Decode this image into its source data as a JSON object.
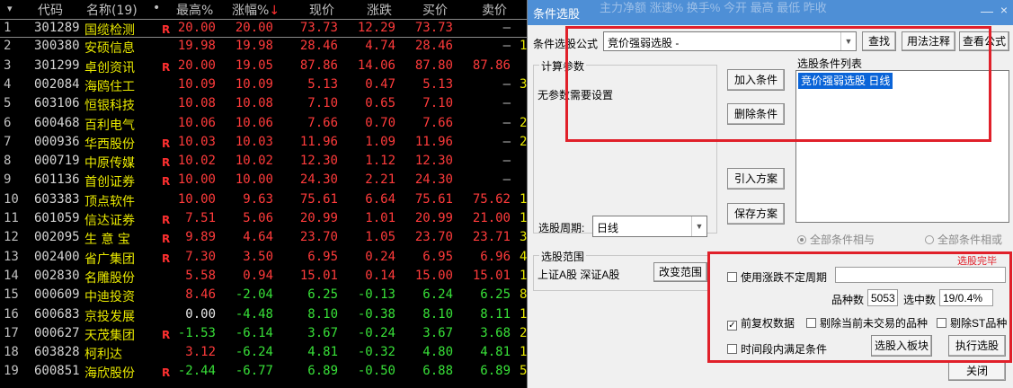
{
  "table": {
    "headers": {
      "menu": "▾",
      "code": "代码",
      "name": "名称(19)",
      "dot": "•",
      "high": "最高%",
      "chg": "涨幅%",
      "chg_sort": "↓",
      "now": "现价",
      "diff": "涨跌",
      "buy": "买价",
      "sell": "卖价"
    },
    "rows": [
      {
        "idx": "1",
        "code": "301289",
        "name": "国缆检测",
        "r": "R",
        "high": "20.00",
        "high_c": "up",
        "chg": "20.00",
        "chg_c": "up",
        "now": "73.73",
        "now_c": "up",
        "diff": "12.29",
        "diff_c": "up",
        "buy": "73.73",
        "buy_c": "up",
        "sell": "–",
        "sell_c": "dash",
        "tail": ""
      },
      {
        "idx": "2",
        "code": "300380",
        "name": "安硕信息",
        "r": "",
        "high": "19.98",
        "high_c": "up",
        "chg": "19.98",
        "chg_c": "up",
        "now": "28.46",
        "now_c": "up",
        "diff": "4.74",
        "diff_c": "up",
        "buy": "28.46",
        "buy_c": "up",
        "sell": "–",
        "sell_c": "dash",
        "tail": "1"
      },
      {
        "idx": "3",
        "code": "301299",
        "name": "卓创资讯",
        "r": "R",
        "high": "20.00",
        "high_c": "up",
        "chg": "19.05",
        "chg_c": "up",
        "now": "87.86",
        "now_c": "up",
        "diff": "14.06",
        "diff_c": "up",
        "buy": "87.80",
        "buy_c": "up",
        "sell": "87.86",
        "sell_c": "up",
        "tail": ""
      },
      {
        "idx": "4",
        "code": "002084",
        "name": "海鸥住工",
        "r": "",
        "high": "10.09",
        "high_c": "up",
        "chg": "10.09",
        "chg_c": "up",
        "now": "5.13",
        "now_c": "up",
        "diff": "0.47",
        "diff_c": "up",
        "buy": "5.13",
        "buy_c": "up",
        "sell": "–",
        "sell_c": "dash",
        "tail": "3"
      },
      {
        "idx": "5",
        "code": "603106",
        "name": "恒银科技",
        "r": "",
        "high": "10.08",
        "high_c": "up",
        "chg": "10.08",
        "chg_c": "up",
        "now": "7.10",
        "now_c": "up",
        "diff": "0.65",
        "diff_c": "up",
        "buy": "7.10",
        "buy_c": "up",
        "sell": "–",
        "sell_c": "dash",
        "tail": ""
      },
      {
        "idx": "6",
        "code": "600468",
        "name": "百利电气",
        "r": "",
        "high": "10.06",
        "high_c": "up",
        "chg": "10.06",
        "chg_c": "up",
        "now": "7.66",
        "now_c": "up",
        "diff": "0.70",
        "diff_c": "up",
        "buy": "7.66",
        "buy_c": "up",
        "sell": "–",
        "sell_c": "dash",
        "tail": "2"
      },
      {
        "idx": "7",
        "code": "000936",
        "name": "华西股份",
        "r": "R",
        "high": "10.03",
        "high_c": "up",
        "chg": "10.03",
        "chg_c": "up",
        "now": "11.96",
        "now_c": "up",
        "diff": "1.09",
        "diff_c": "up",
        "buy": "11.96",
        "buy_c": "up",
        "sell": "–",
        "sell_c": "dash",
        "tail": "2"
      },
      {
        "idx": "8",
        "code": "000719",
        "name": "中原传媒",
        "r": "R",
        "high": "10.02",
        "high_c": "up",
        "chg": "10.02",
        "chg_c": "up",
        "now": "12.30",
        "now_c": "up",
        "diff": "1.12",
        "diff_c": "up",
        "buy": "12.30",
        "buy_c": "up",
        "sell": "–",
        "sell_c": "dash",
        "tail": ""
      },
      {
        "idx": "9",
        "code": "601136",
        "name": "首创证券",
        "r": "R",
        "high": "10.00",
        "high_c": "up",
        "chg": "10.00",
        "chg_c": "up",
        "now": "24.30",
        "now_c": "up",
        "diff": "2.21",
        "diff_c": "up",
        "buy": "24.30",
        "buy_c": "up",
        "sell": "–",
        "sell_c": "dash",
        "tail": ""
      },
      {
        "idx": "10",
        "code": "603383",
        "name": "顶点软件",
        "r": "",
        "high": "10.00",
        "high_c": "up",
        "chg": "9.63",
        "chg_c": "up",
        "now": "75.61",
        "now_c": "up",
        "diff": "6.64",
        "diff_c": "up",
        "buy": "75.61",
        "buy_c": "up",
        "sell": "75.62",
        "sell_c": "up",
        "tail": "1"
      },
      {
        "idx": "11",
        "code": "601059",
        "name": "信达证券",
        "r": "R",
        "high": "7.51",
        "high_c": "up",
        "chg": "5.06",
        "chg_c": "up",
        "now": "20.99",
        "now_c": "up",
        "diff": "1.01",
        "diff_c": "up",
        "buy": "20.99",
        "buy_c": "up",
        "sell": "21.00",
        "sell_c": "up",
        "tail": "1"
      },
      {
        "idx": "12",
        "code": "002095",
        "name": "生 意 宝",
        "r": "R",
        "high": "9.89",
        "high_c": "up",
        "chg": "4.64",
        "chg_c": "up",
        "now": "23.70",
        "now_c": "up",
        "diff": "1.05",
        "diff_c": "up",
        "buy": "23.70",
        "buy_c": "up",
        "sell": "23.71",
        "sell_c": "up",
        "tail": "3"
      },
      {
        "idx": "13",
        "code": "002400",
        "name": "省广集团",
        "r": "R",
        "high": "7.30",
        "high_c": "up",
        "chg": "3.50",
        "chg_c": "up",
        "now": "6.95",
        "now_c": "up",
        "diff": "0.24",
        "diff_c": "up",
        "buy": "6.95",
        "buy_c": "up",
        "sell": "6.96",
        "sell_c": "up",
        "tail": "4"
      },
      {
        "idx": "14",
        "code": "002830",
        "name": "名雕股份",
        "r": "",
        "high": "5.58",
        "high_c": "up",
        "chg": "0.94",
        "chg_c": "up",
        "now": "15.01",
        "now_c": "up",
        "diff": "0.14",
        "diff_c": "up",
        "buy": "15.00",
        "buy_c": "up",
        "sell": "15.01",
        "sell_c": "up",
        "tail": "1"
      },
      {
        "idx": "15",
        "code": "000609",
        "name": "中迪投资",
        "r": "",
        "high": "8.46",
        "high_c": "up",
        "chg": "-2.04",
        "chg_c": "down",
        "now": "6.25",
        "now_c": "down",
        "diff": "-0.13",
        "diff_c": "down",
        "buy": "6.24",
        "buy_c": "down",
        "sell": "6.25",
        "sell_c": "down",
        "tail": "8"
      },
      {
        "idx": "16",
        "code": "600683",
        "name": "京投发展",
        "r": "",
        "high": "0.00",
        "high_c": "flat",
        "chg": "-4.48",
        "chg_c": "down",
        "now": "8.10",
        "now_c": "down",
        "diff": "-0.38",
        "diff_c": "down",
        "buy": "8.10",
        "buy_c": "down",
        "sell": "8.11",
        "sell_c": "down",
        "tail": "1"
      },
      {
        "idx": "17",
        "code": "000627",
        "name": "天茂集团",
        "r": "R",
        "high": "-1.53",
        "high_c": "down",
        "chg": "-6.14",
        "chg_c": "down",
        "now": "3.67",
        "now_c": "down",
        "diff": "-0.24",
        "diff_c": "down",
        "buy": "3.67",
        "buy_c": "down",
        "sell": "3.68",
        "sell_c": "down",
        "tail": "2"
      },
      {
        "idx": "18",
        "code": "603828",
        "name": "柯利达",
        "r": "",
        "high": "3.12",
        "high_c": "up",
        "chg": "-6.24",
        "chg_c": "down",
        "now": "4.81",
        "now_c": "down",
        "diff": "-0.32",
        "diff_c": "down",
        "buy": "4.80",
        "buy_c": "down",
        "sell": "4.81",
        "sell_c": "down",
        "tail": "1"
      },
      {
        "idx": "19",
        "code": "600851",
        "name": "海欣股份",
        "r": "R",
        "high": "-2.44",
        "high_c": "down",
        "chg": "-6.77",
        "chg_c": "down",
        "now": "6.89",
        "now_c": "down",
        "diff": "-0.50",
        "diff_c": "down",
        "buy": "6.88",
        "buy_c": "down",
        "sell": "6.89",
        "sell_c": "down",
        "tail": "5"
      }
    ]
  },
  "dialog": {
    "title": "条件选股",
    "ghost_header": "主力净额   涨速%   换手%    今开    最高    最低    昨收",
    "minimize": "—",
    "close_x": "×",
    "formula_label": "条件选股公式",
    "formula_value": "竞价强弱选股 -",
    "find_btn": "查找",
    "usage_btn": "用法注释",
    "view_formula_btn": "查看公式",
    "params_group": "计算参数",
    "params_text": "无参数需要设置",
    "add_btn": "加入条件",
    "delete_btn": "删除条件",
    "import_btn": "引入方案",
    "save_btn": "保存方案",
    "cond_list_label": "选股条件列表",
    "cond_items": [
      "竞价强弱选股  日线"
    ],
    "period_label": "选股周期:",
    "period_value": "日线",
    "radio_and": "全部条件相与",
    "radio_or": "全部条件相或",
    "scope_group": "选股范围",
    "scope_value": "上证A股 深证A股",
    "change_scope_btn": "改变范围",
    "red_label": "选股完毕",
    "use_period_label": "使用涨跌不定周期",
    "count_label": "品种数",
    "count_value": "5053",
    "selected_label": "选中数",
    "selected_value": "19/0.4%",
    "pre_rights_label": "前复权数据",
    "exclude_untraded_label": "剔除当前未交易的品种",
    "exclude_st_label": "剔除ST品种",
    "time_range_label": "时间段内满足条件",
    "to_block_btn": "选股入板块",
    "run_btn": "执行选股",
    "close_btn": "关闭",
    "accent_color": "#e0202a"
  }
}
